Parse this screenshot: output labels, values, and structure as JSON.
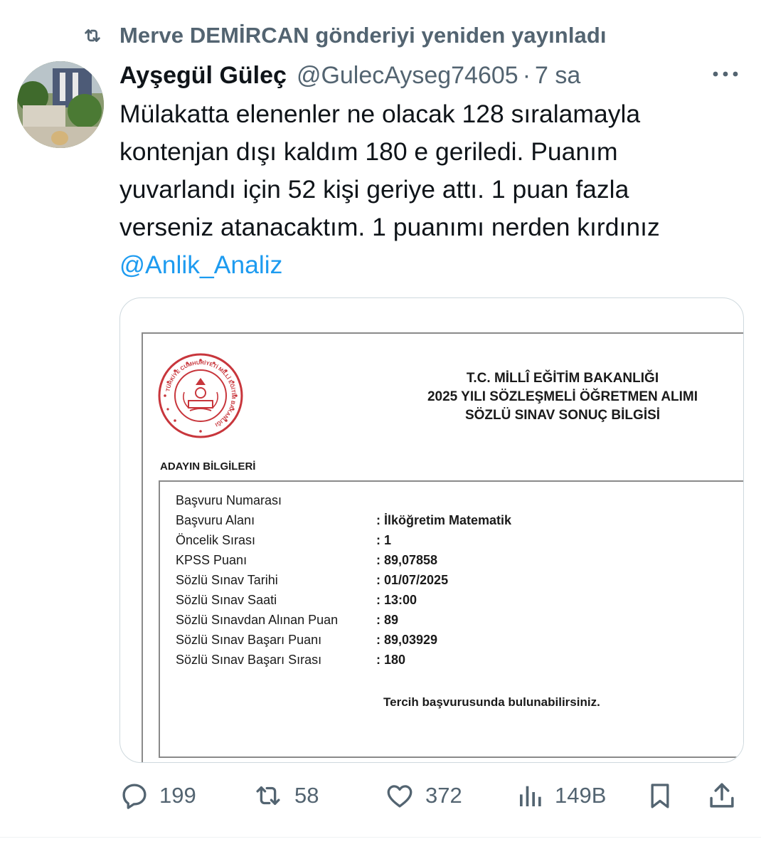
{
  "repost": {
    "text": "Merve DEMİRCAN gönderiyi yeniden yayınladı"
  },
  "tweet": {
    "display_name": "Ayşegül Güleç",
    "handle": "@GulecAyseg74605",
    "separator": "·",
    "time": "7 sa",
    "text_lines": [
      "Mülakatta elenenler ne olacak 128 sıralamayla",
      "kontenjan dışı kaldım 180 e geriledi. Puanım",
      "yuvarlandı için 52 kişi geriye attı. 1 puan fazla",
      "verseniz atanacaktım. 1 puanımı nerden kırdınız"
    ],
    "mention": "@Anlik_Analiz"
  },
  "document": {
    "seal_text": "TÜRKİYE CUMHURİYETİ MİLLÎ EĞİTİM BAKANLIĞI",
    "header_lines": [
      "T.C. MİLLÎ EĞİTİM BAKANLIĞI",
      "2025 YILI SÖZLEŞMELİ ÖĞRETMEN ALIMI",
      "SÖZLÜ SINAV SONUÇ BİLGİSİ"
    ],
    "section_title": "ADAYIN BİLGİLERİ",
    "rows": [
      {
        "label": "Başvuru Numarası",
        "value": ""
      },
      {
        "label": "Başvuru Alanı",
        "value": ": İlköğretim Matematik"
      },
      {
        "label": "Öncelik Sırası",
        "value": ": 1"
      },
      {
        "label": "KPSS Puanı",
        "value": ": 89,07858"
      },
      {
        "label": "Sözlü Sınav Tarihi",
        "value": ": 01/07/2025"
      },
      {
        "label": "Sözlü Sınav Saati",
        "value": ": 13:00"
      },
      {
        "label": "Sözlü Sınavdan Alınan Puan",
        "value": ": 89"
      },
      {
        "label": "Sözlü Sınav Başarı Puanı",
        "value": ": 89,03929"
      },
      {
        "label": "Sözlü Sınav Başarı Sırası",
        "value": ": 180"
      }
    ],
    "note": "Tercih başvurusunda bulunabilirsiniz."
  },
  "actions": {
    "replies": "199",
    "reposts": "58",
    "likes": "372",
    "views": "149B"
  },
  "icons": {
    "repost": "repost-icon",
    "more": "more-icon",
    "reply": "reply-icon",
    "like": "heart-icon",
    "views": "views-icon",
    "bookmark": "bookmark-icon",
    "share": "share-icon"
  },
  "colors": {
    "text": "#0f1419",
    "secondary": "#536471",
    "link": "#1d9bf0",
    "border": "#cfd9de",
    "seal": "#c8363c"
  }
}
